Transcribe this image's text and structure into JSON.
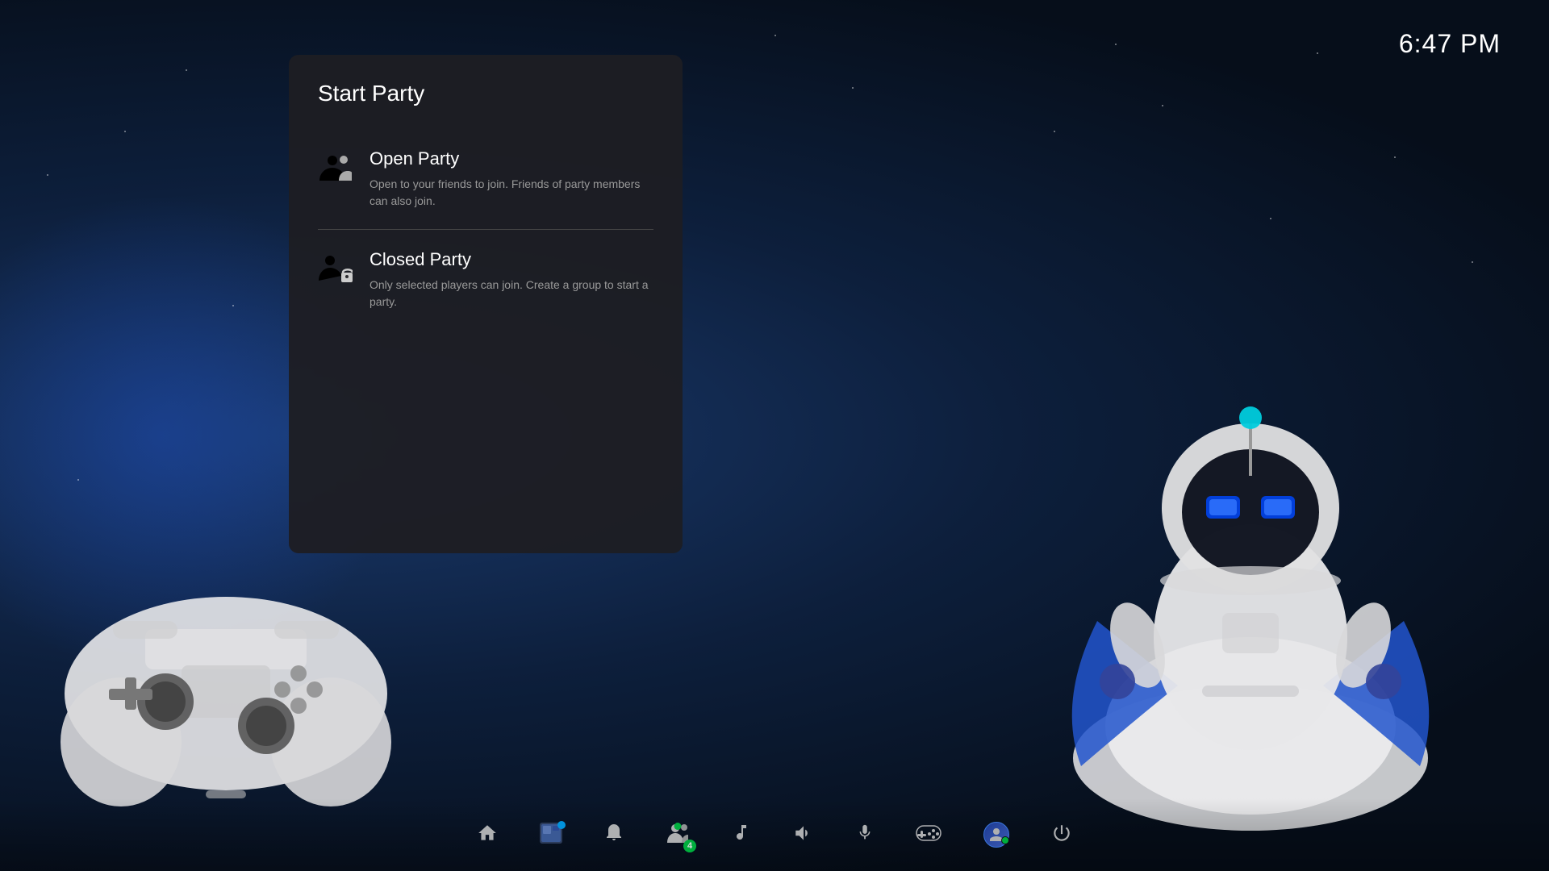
{
  "clock": {
    "time": "6:47 PM"
  },
  "modal": {
    "title": "Start Party",
    "open_party": {
      "title": "Open Party",
      "description": "Open to your friends to join. Friends of party members can also join."
    },
    "closed_party": {
      "title": "Closed Party",
      "description": "Only selected players can join. Create a group to start a party."
    }
  },
  "taskbar": {
    "items": [
      {
        "name": "home",
        "icon": "home",
        "badge": null,
        "dot": null
      },
      {
        "name": "game",
        "icon": "game",
        "badge": null,
        "dot": "blue"
      },
      {
        "name": "notifications",
        "icon": "bell",
        "badge": null,
        "dot": null
      },
      {
        "name": "friends",
        "icon": "friends",
        "badge": "4",
        "dot": "green"
      },
      {
        "name": "music",
        "icon": "music",
        "badge": null,
        "dot": null
      },
      {
        "name": "volume",
        "icon": "volume",
        "badge": null,
        "dot": null
      },
      {
        "name": "mic",
        "icon": "mic",
        "badge": null,
        "dot": null
      },
      {
        "name": "controller",
        "icon": "gamepad",
        "badge": null,
        "dot": null
      },
      {
        "name": "profile",
        "icon": "profile",
        "badge": null,
        "dot": "green"
      },
      {
        "name": "power",
        "icon": "power",
        "badge": null,
        "dot": null
      }
    ]
  }
}
